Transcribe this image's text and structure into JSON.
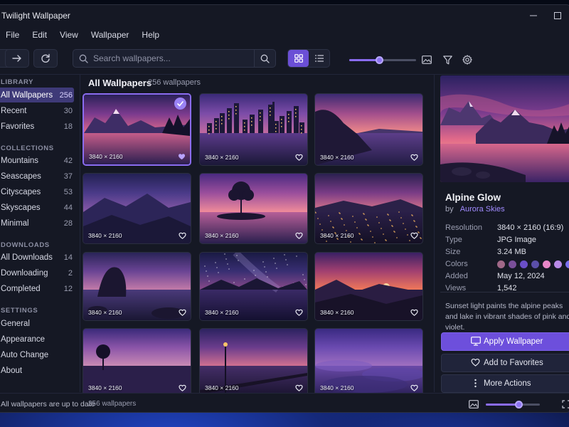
{
  "app": {
    "title": "Twilight Wallpaper",
    "accent_color": "#6b4fd6"
  },
  "menu": [
    "File",
    "Edit",
    "View",
    "Wallpaper",
    "Help"
  ],
  "toolbar": {
    "search_placeholder": "Search wallpapers...",
    "view_modes": [
      "grid-icon",
      "list-icon"
    ],
    "active_view": "grid",
    "thumbnail_size_level": 0.45
  },
  "sidebar": {
    "sections": [
      {
        "title": "LIBRARY",
        "items": [
          {
            "label": "All Wallpapers",
            "count": "256",
            "active": true
          },
          {
            "label": "Recent",
            "count": "30"
          },
          {
            "label": "Favorites",
            "count": "18"
          }
        ]
      },
      {
        "title": "COLLECTIONS",
        "items": [
          {
            "label": "Mountains",
            "count": "42"
          },
          {
            "label": "Seascapes",
            "count": "37"
          },
          {
            "label": "Cityscapes",
            "count": "53"
          },
          {
            "label": "Skyscapes",
            "count": "44"
          },
          {
            "label": "Minimal",
            "count": "28"
          }
        ]
      },
      {
        "title": "DOWNLOADS",
        "items": [
          {
            "label": "All Downloads",
            "count": "14"
          },
          {
            "label": "Downloading",
            "count": "2"
          },
          {
            "label": "Completed",
            "count": "12"
          }
        ]
      },
      {
        "title": "SETTINGS",
        "items": [
          {
            "label": "General"
          },
          {
            "label": "Appearance"
          },
          {
            "label": "Auto Change"
          },
          {
            "label": "About"
          }
        ]
      }
    ]
  },
  "content": {
    "title": "All Wallpapers",
    "count": "256 wallpapers",
    "thumbnails": [
      {
        "scene": "alpine-glow",
        "resolution": "3840 × 2160",
        "favorite": true,
        "selected": true
      },
      {
        "scene": "city-skyline",
        "resolution": "3840 × 2160",
        "favorite": false
      },
      {
        "scene": "coast-cliffs",
        "resolution": "3840 × 2160",
        "favorite": false
      },
      {
        "scene": "misty-mountains",
        "resolution": "3840 × 2160",
        "favorite": false
      },
      {
        "scene": "lone-tree-island",
        "resolution": "3840 × 2160",
        "favorite": false
      },
      {
        "scene": "city-lights",
        "resolution": "3840 × 2160",
        "favorite": false
      },
      {
        "scene": "rocky-shore",
        "resolution": "3840 × 2160",
        "favorite": false
      },
      {
        "scene": "milky-way",
        "resolution": "3840 × 2160",
        "favorite": false
      },
      {
        "scene": "sunset-valley",
        "resolution": "3840 × 2160",
        "favorite": false
      },
      {
        "scene": "tree-meadow",
        "resolution": "3840 × 2160",
        "favorite": false
      },
      {
        "scene": "lamp-promenade",
        "resolution": "3840 × 2160",
        "favorite": false
      },
      {
        "scene": "cloudscape",
        "resolution": "3840 × 2160",
        "favorite": false
      }
    ]
  },
  "details": {
    "title": "Alpine Glow",
    "by_label": "by",
    "author": "Aurora Skies",
    "fields": [
      {
        "key": "Resolution",
        "value": "3840 × 2160 (16:9)"
      },
      {
        "key": "Type",
        "value": "JPG Image"
      },
      {
        "key": "Size",
        "value": "3.24 MB"
      },
      {
        "key": "Colors",
        "value": ""
      },
      {
        "key": "Added",
        "value": "May 12, 2024"
      },
      {
        "key": "Views",
        "value": "1,542"
      }
    ],
    "colors": [
      "#a06888",
      "#7a4f99",
      "#6a4fc8",
      "#5b4fa8",
      "#e887c8",
      "#b98ae8",
      "#7c70f0"
    ],
    "description": "Sunset light paints the alpine peaks and lake in vibrant shades of pink and violet.",
    "actions": {
      "apply": "Apply Wallpaper",
      "favorite": "Add to Favorites",
      "more": "More Actions"
    }
  },
  "status": {
    "left": "All wallpapers are up to date",
    "count": "256 wallpapers",
    "zoom_level": 0.6
  }
}
